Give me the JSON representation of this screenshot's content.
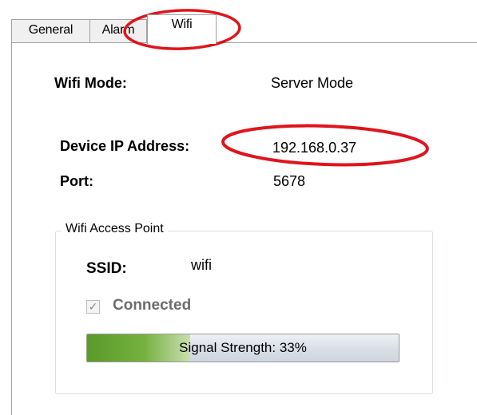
{
  "tabs": [
    {
      "label": "General",
      "selected": false
    },
    {
      "label": "Alarm",
      "selected": false
    },
    {
      "label": "Wifi",
      "selected": true
    }
  ],
  "wifi": {
    "mode_label": "Wifi Mode:",
    "mode_value": "Server Mode",
    "ip_label": "Device IP Address:",
    "ip_value": "192.168.0.37",
    "port_label": "Port:",
    "port_value": "5678"
  },
  "access_point": {
    "group_title": "Wifi Access Point",
    "ssid_label": "SSID:",
    "ssid_value": "wifi",
    "connected_label": "Connected",
    "connected_checked": true,
    "signal_text": "Signal Strength: 33%",
    "signal_fraction": 0.33
  },
  "colors": {
    "annotation_red": "#e0141b",
    "progress_green": "#6aa935"
  }
}
